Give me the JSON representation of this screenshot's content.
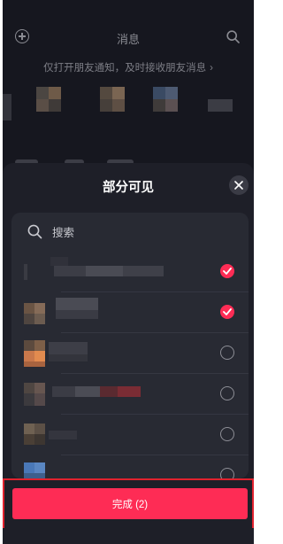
{
  "background": {
    "title": "消息",
    "notice": "仅打开朋友通知，及时接收朋友消息",
    "notice_arrow": "›",
    "icons": {
      "add": "add-circle-icon",
      "search": "search-icon"
    }
  },
  "sheet": {
    "title": "部分可见",
    "close_icon": "close-icon",
    "search": {
      "placeholder": "搜索",
      "value": ""
    },
    "contacts": [
      {
        "name": "",
        "selected": true
      },
      {
        "name": "",
        "selected": true
      },
      {
        "name": "",
        "selected": false
      },
      {
        "name": "",
        "selected": false
      },
      {
        "name": "",
        "selected": false
      },
      {
        "name": "",
        "selected": false
      }
    ],
    "done_label": "完成 (2)"
  },
  "colors": {
    "accent": "#fe2c55",
    "background": "#16171f",
    "sheet": "#1e1f28",
    "card": "#282a33",
    "highlight_frame": "#e0222e"
  }
}
